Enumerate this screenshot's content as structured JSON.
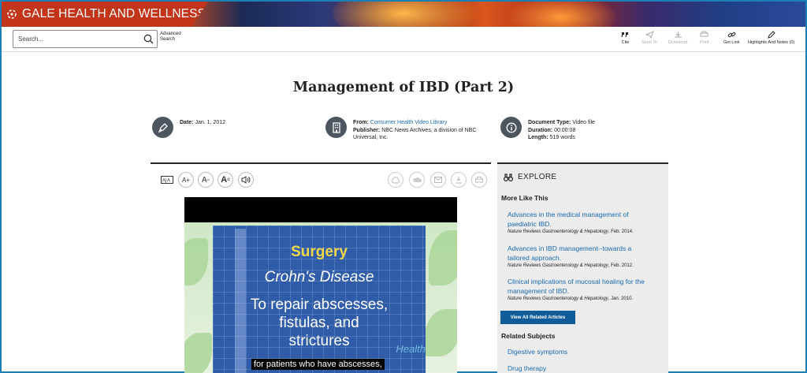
{
  "header": {
    "brand": "GALE HEALTH AND WELLNESS"
  },
  "search": {
    "placeholder": "Search...",
    "advanced_line1": "Advanced",
    "advanced_line2": "Search"
  },
  "tools": [
    {
      "label": "Cite",
      "icon": "cite-icon",
      "enabled": true
    },
    {
      "label": "Send To",
      "icon": "send-icon",
      "enabled": false
    },
    {
      "label": "Download",
      "icon": "download-icon",
      "enabled": false
    },
    {
      "label": "Print",
      "icon": "print-icon",
      "enabled": false
    },
    {
      "label": "Get Link",
      "icon": "link-icon",
      "enabled": true
    },
    {
      "label": "Highlights And Notes (0)",
      "icon": "pen-icon",
      "enabled": true
    }
  ],
  "document": {
    "title": "Management of IBD (Part 2)",
    "date_label": "Date:",
    "date": "Jan. 1, 2012",
    "from_label": "From:",
    "from": "Consumer Health Video Library",
    "publisher_label": "Publisher:",
    "publisher": "NBC News Archives, a division of NBC",
    "publisher2": "Universal, Inc.",
    "doctype_label": "Document Type:",
    "doctype": "Video file",
    "duration_label": "Duration:",
    "duration": "00:00:08",
    "length_label": "Length:",
    "length": "519 words"
  },
  "video": {
    "slide_line1": "Surgery",
    "slide_line2": "Crohn's Disease",
    "slide_line3": "To repair abscesses,",
    "slide_line4": "fistulas, and",
    "slide_line5": "strictures",
    "subtitle": "for patients who have abscesses,",
    "logo_text": "Health"
  },
  "explore": {
    "heading": "EXPLORE",
    "more_like_this": "More Like This",
    "articles": [
      {
        "title_line1": "Advances in the medical management of",
        "title_line2": "paediatric IBD.",
        "source": "Nature Reviews Gastroenterology & Hepatology",
        "date": "Feb. 2014."
      },
      {
        "title_line1": "Advances in IBD management--towards a",
        "title_line2": "tailored approach.",
        "source": "Nature Reviews Gastroenterology & Hepatology",
        "date": "Feb. 2012."
      },
      {
        "title_line1": "Clinical implications of mucosal healing for the",
        "title_line2": "management of IBD.",
        "source": "Nature Reviews Gastroenterology & Hepatology",
        "date": "Jan. 2010."
      }
    ],
    "view_all": "View All Related Articles",
    "related_subjects": "Related Subjects",
    "subjects": [
      "Digestive symptoms",
      "Drug therapy"
    ]
  },
  "controls": {
    "translate": "translate-icon",
    "font_up": "A+",
    "font_down": "A-",
    "font_style": "A",
    "listen": "speaker-icon"
  }
}
